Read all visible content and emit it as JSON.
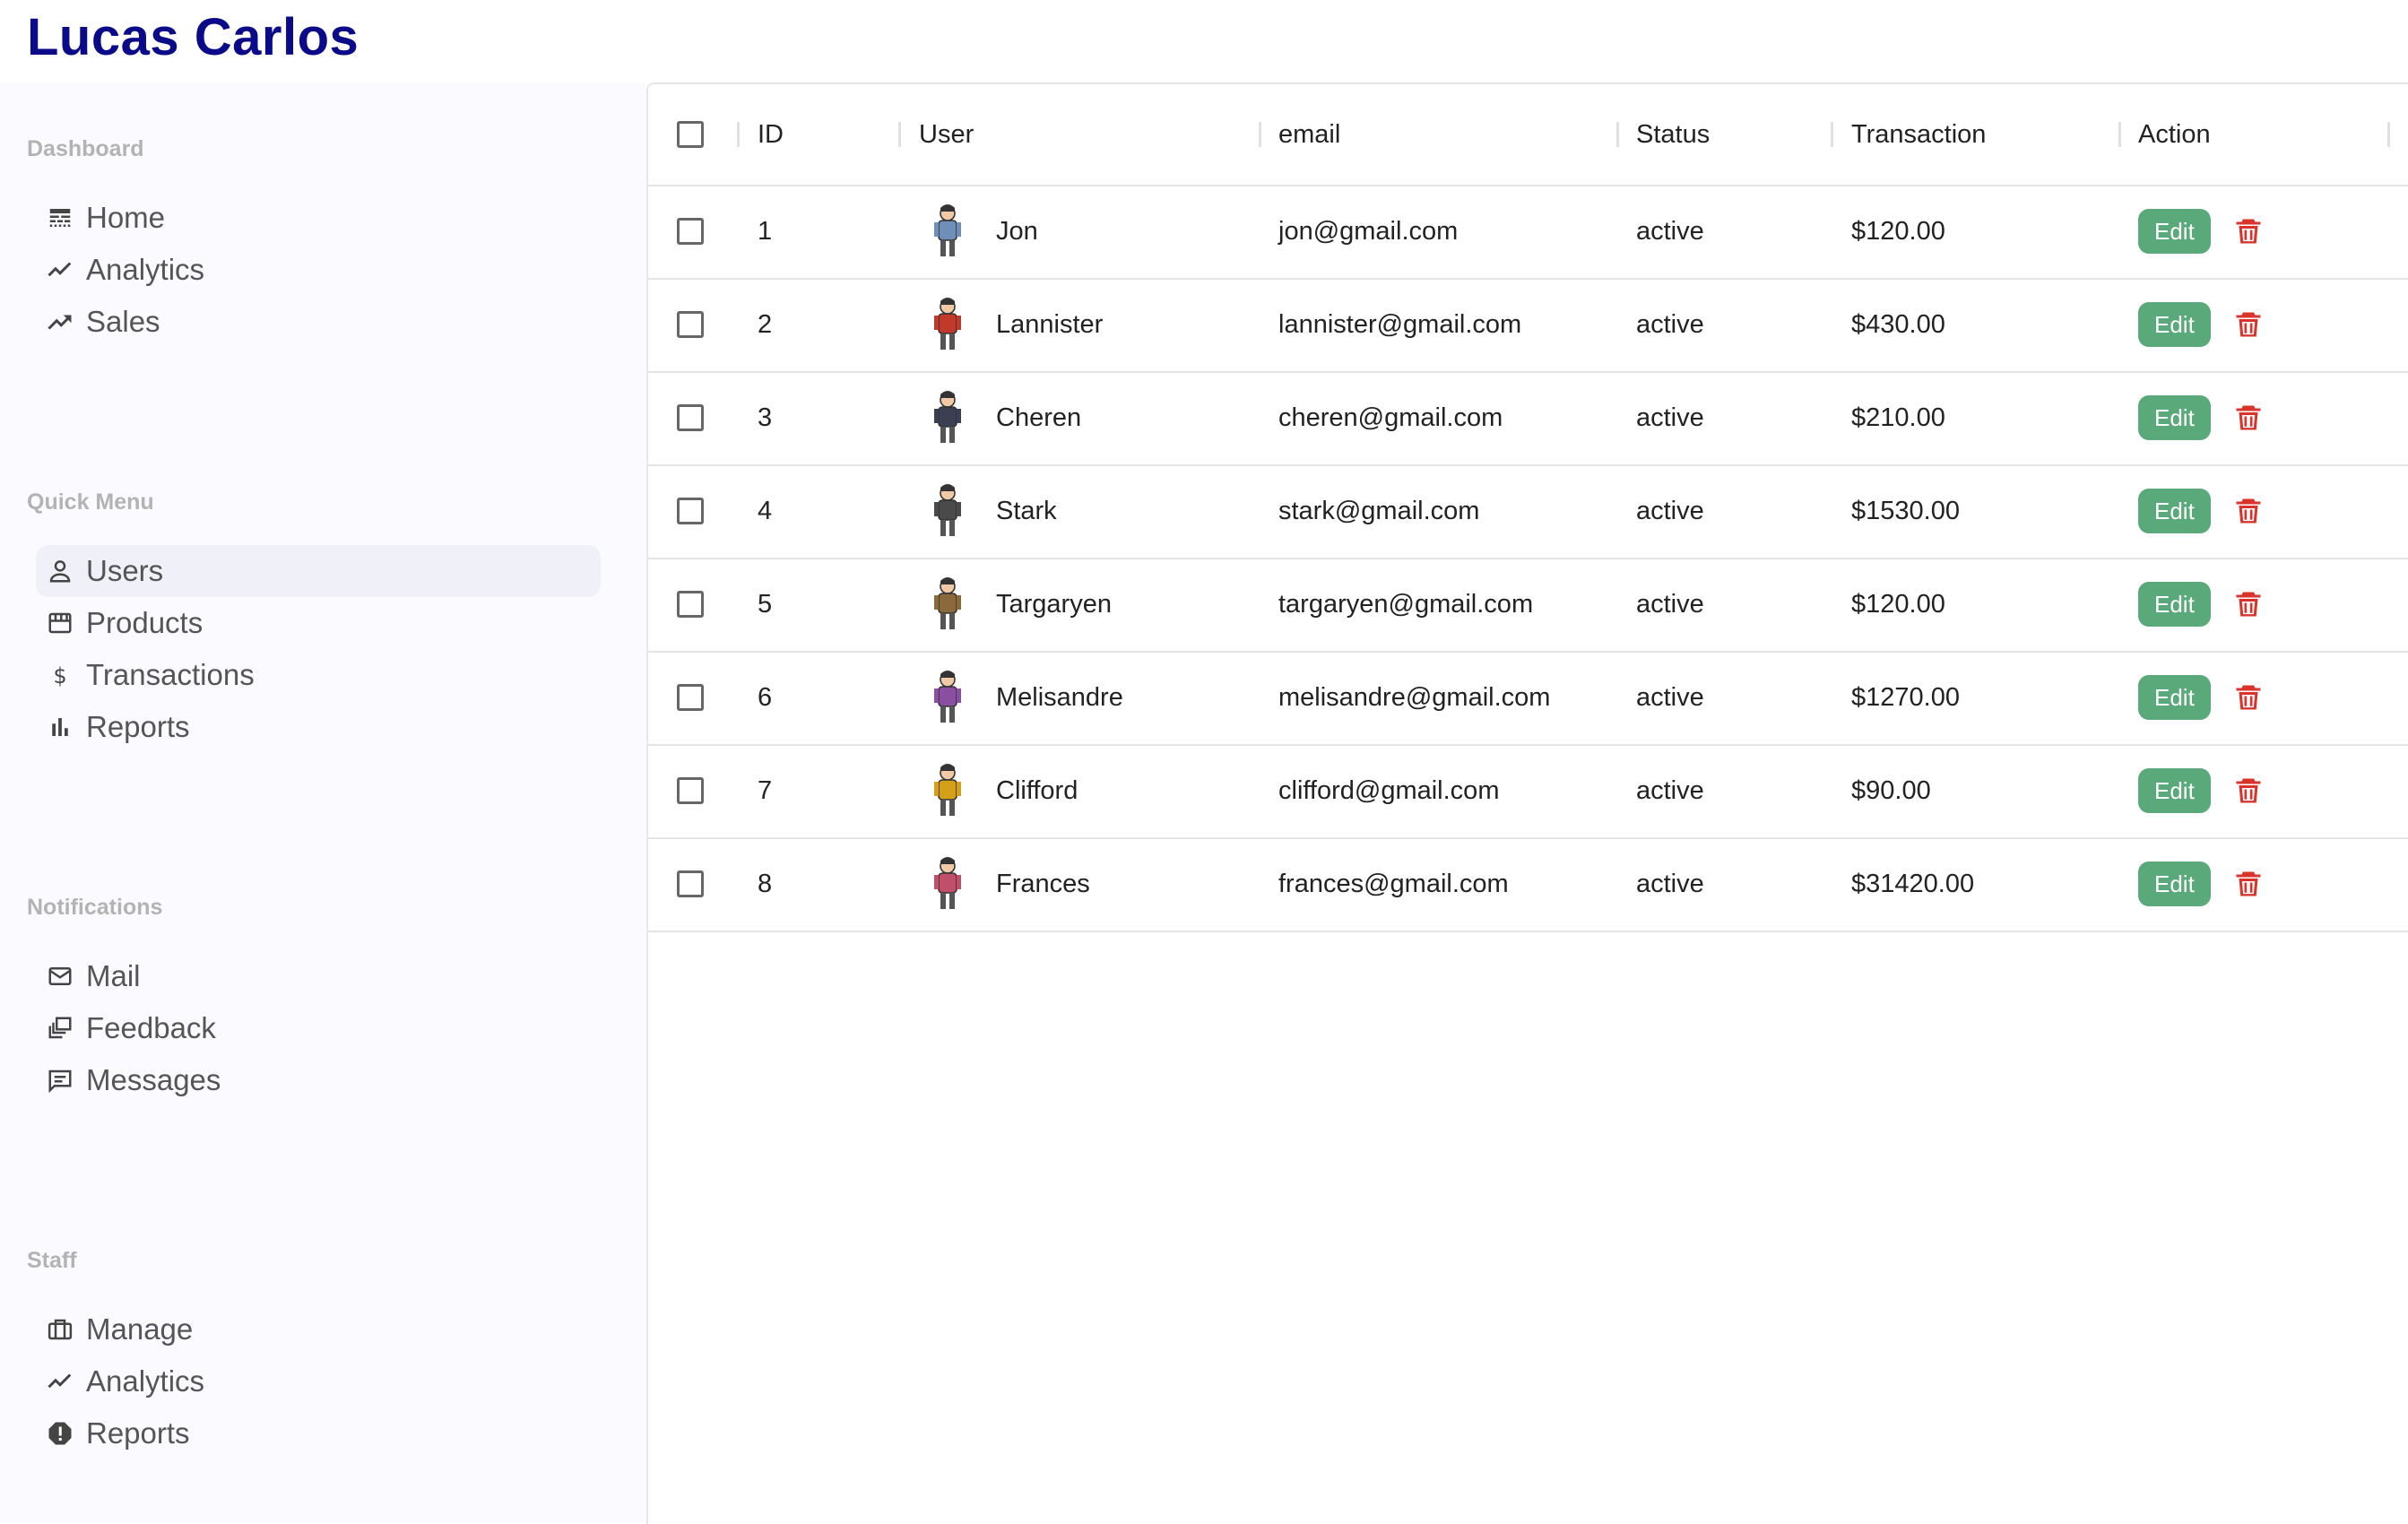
{
  "app": {
    "title": "Lucas Carlos"
  },
  "sidebar": {
    "sections": [
      {
        "title": "Dashboard",
        "items": [
          {
            "label": "Home",
            "icon": "line-style-icon"
          },
          {
            "label": "Analytics",
            "icon": "trending-line-icon"
          },
          {
            "label": "Sales",
            "icon": "trending-up-icon"
          }
        ]
      },
      {
        "title": "Quick Menu",
        "items": [
          {
            "label": "Users",
            "icon": "person-outline-icon",
            "active": true
          },
          {
            "label": "Products",
            "icon": "storefront-icon"
          },
          {
            "label": "Transactions",
            "icon": "dollar-icon"
          },
          {
            "label": "Reports",
            "icon": "bar-chart-icon"
          }
        ]
      },
      {
        "title": "Notifications",
        "items": [
          {
            "label": "Mail",
            "icon": "mail-outline-icon"
          },
          {
            "label": "Feedback",
            "icon": "dynamic-feed-icon"
          },
          {
            "label": "Messages",
            "icon": "chat-outline-icon"
          }
        ]
      },
      {
        "title": "Staff",
        "items": [
          {
            "label": "Manage",
            "icon": "briefcase-icon"
          },
          {
            "label": "Analytics",
            "icon": "trending-line-icon"
          },
          {
            "label": "Reports",
            "icon": "report-octagon-icon"
          }
        ]
      }
    ]
  },
  "table": {
    "columns": [
      "ID",
      "User",
      "email",
      "Status",
      "Transaction",
      "Action"
    ],
    "edit_label": "Edit",
    "rows": [
      {
        "id": "1",
        "user": "Jon",
        "email": "jon@gmail.com",
        "status": "active",
        "transaction": "$120.00",
        "avatar_color": "#6f8fb8"
      },
      {
        "id": "2",
        "user": "Lannister",
        "email": "lannister@gmail.com",
        "status": "active",
        "transaction": "$430.00",
        "avatar_color": "#c0392b"
      },
      {
        "id": "3",
        "user": "Cheren",
        "email": "cheren@gmail.com",
        "status": "active",
        "transaction": "$210.00",
        "avatar_color": "#3a3f52"
      },
      {
        "id": "4",
        "user": "Stark",
        "email": "stark@gmail.com",
        "status": "active",
        "transaction": "$1530.00",
        "avatar_color": "#4a4a4a"
      },
      {
        "id": "5",
        "user": "Targaryen",
        "email": "targaryen@gmail.com",
        "status": "active",
        "transaction": "$120.00",
        "avatar_color": "#8a6a3a"
      },
      {
        "id": "6",
        "user": "Melisandre",
        "email": "melisandre@gmail.com",
        "status": "active",
        "transaction": "$1270.00",
        "avatar_color": "#8a4fa0"
      },
      {
        "id": "7",
        "user": "Clifford",
        "email": "clifford@gmail.com",
        "status": "active",
        "transaction": "$90.00",
        "avatar_color": "#d4a017"
      },
      {
        "id": "8",
        "user": "Frances",
        "email": "frances@gmail.com",
        "status": "active",
        "transaction": "$31420.00",
        "avatar_color": "#c0506a"
      }
    ]
  },
  "colors": {
    "brand": "#0b0b8a",
    "edit": "#5aa97a",
    "delete": "#d9342b"
  }
}
